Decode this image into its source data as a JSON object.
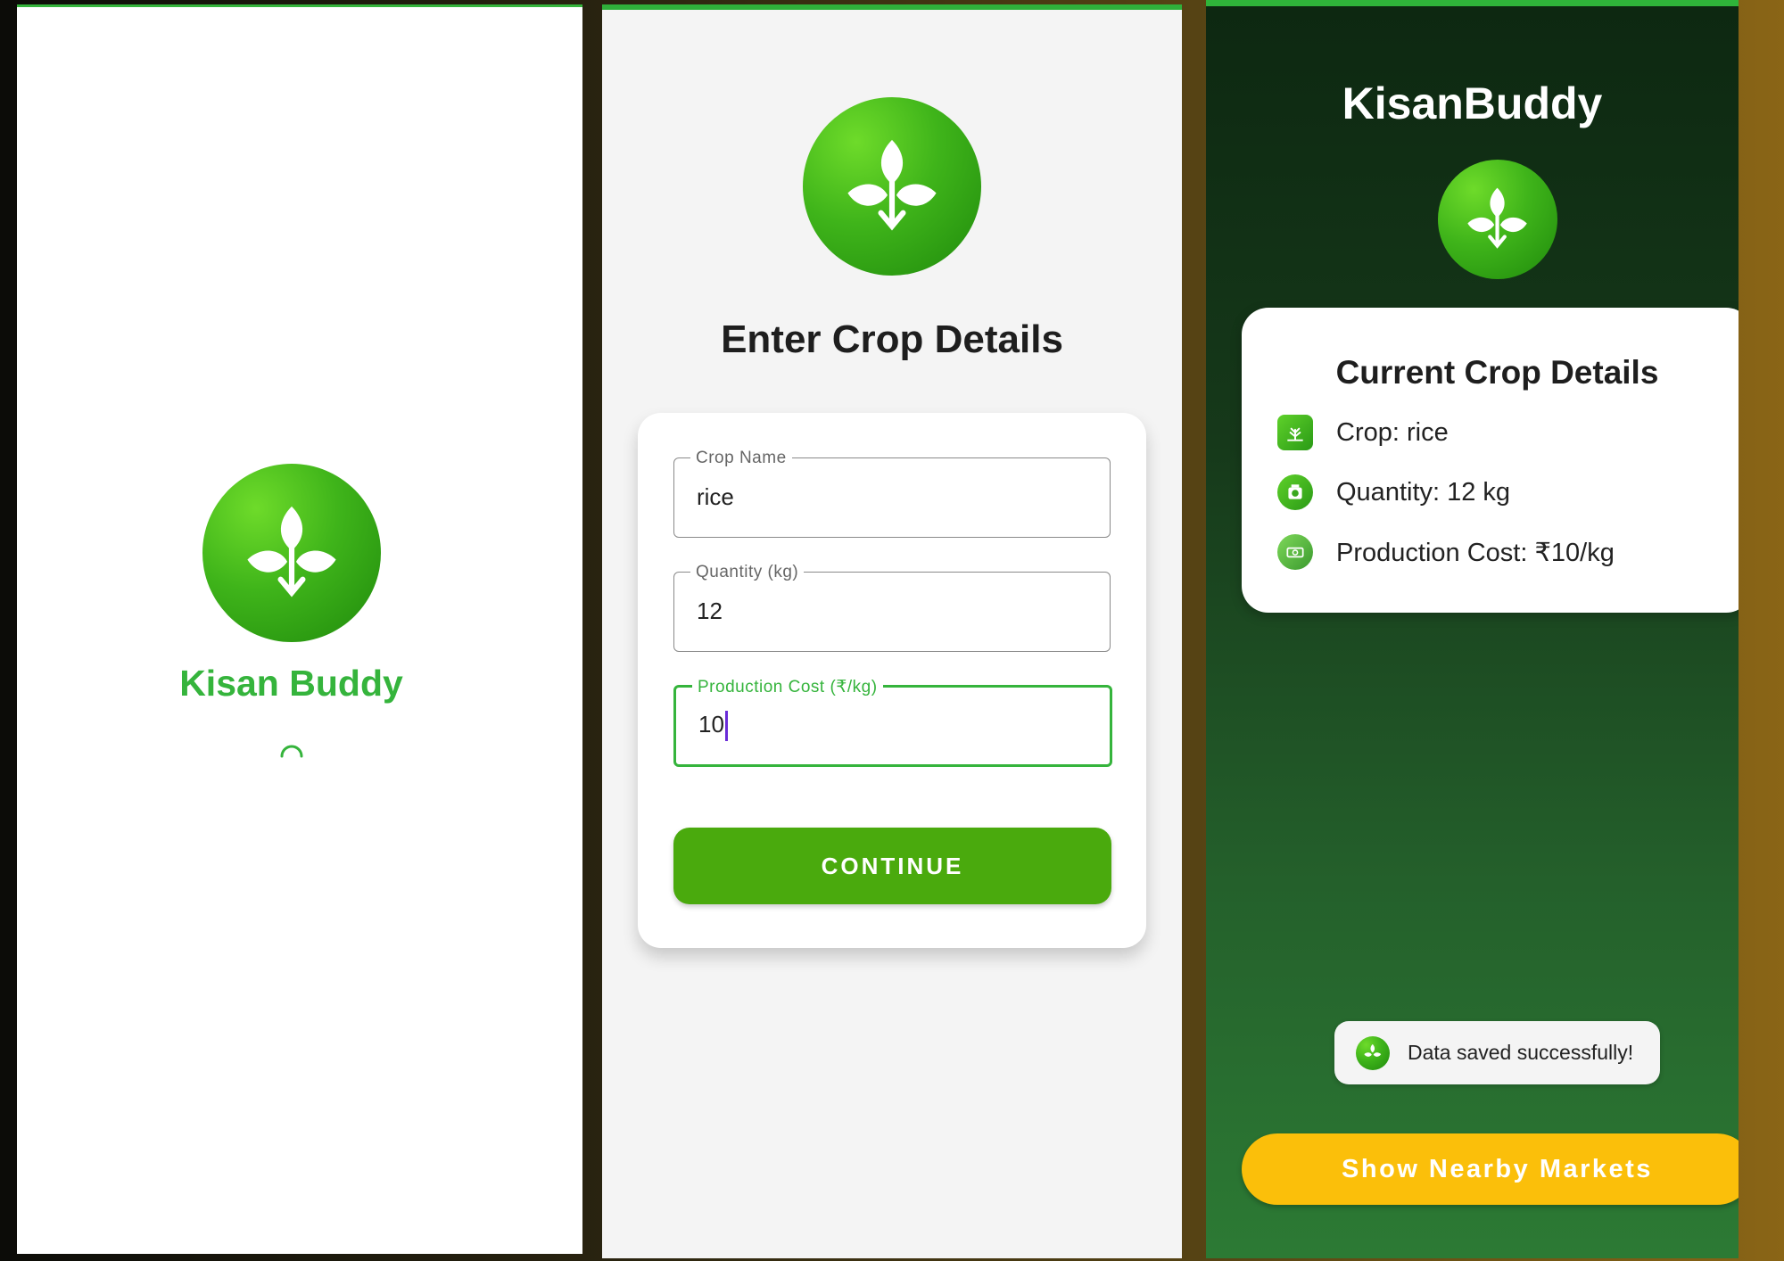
{
  "splash": {
    "app_name": "Kisan Buddy",
    "logo_icon": "leaf-sprout-icon",
    "loading_icon": "spinner-icon"
  },
  "form": {
    "title": "Enter Crop Details",
    "fields": [
      {
        "label": "Crop Name",
        "value": "rice"
      },
      {
        "label": "Quantity (kg)",
        "value": "12"
      },
      {
        "label": "Production Cost (₹/kg)",
        "value": "10"
      }
    ],
    "continue_label": "CONTINUE"
  },
  "summary": {
    "app_title": "KisanBuddy",
    "card_title": "Current Crop Details",
    "rows": [
      {
        "icon": "crop-icon",
        "text": "Crop: rice"
      },
      {
        "icon": "weight-scale-icon",
        "text": "Quantity: 12 kg"
      },
      {
        "icon": "money-icon",
        "text": "Production Cost: ₹10/kg"
      }
    ],
    "toast_text": "Data saved successfully!",
    "markets_button_label": "Show Nearby Markets"
  },
  "colors": {
    "brand_green": "#35b43c",
    "button_green": "#4aaa0d",
    "markets_yellow": "#fbbf0a",
    "dark_green_bg": "#16391a"
  }
}
